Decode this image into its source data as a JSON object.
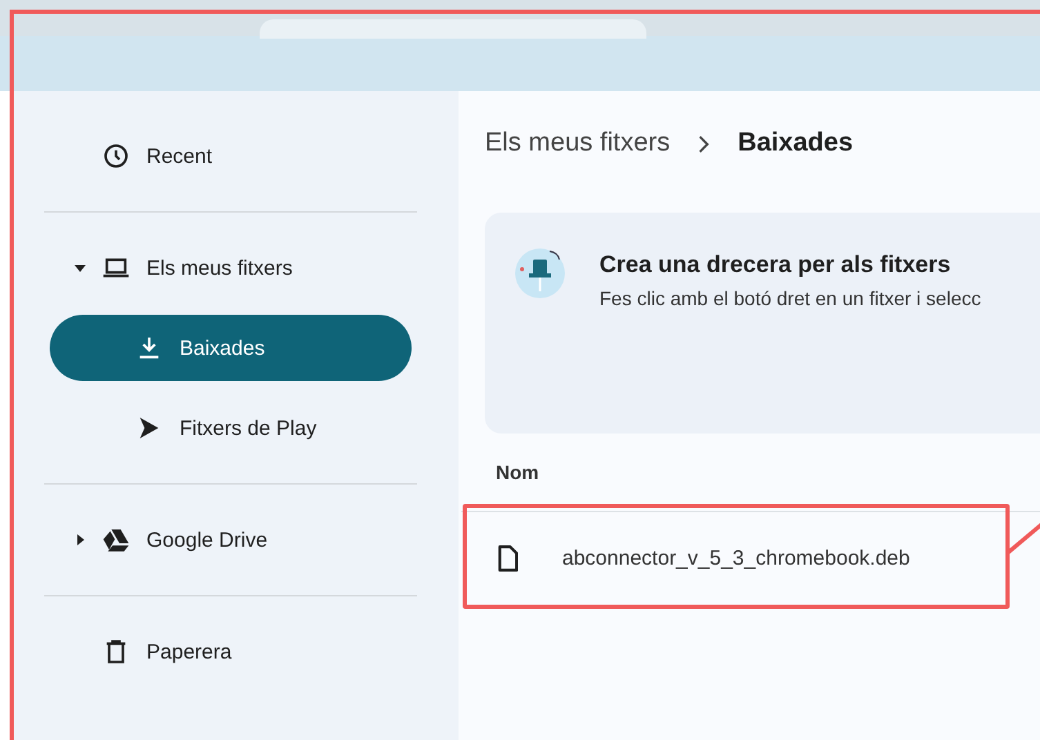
{
  "sidebar": {
    "groups": [
      [
        {
          "kind": "recent",
          "label": "Recent",
          "selected": false
        }
      ],
      [
        {
          "kind": "device",
          "label": "Els meus fitxers",
          "selected": false,
          "expanded": true,
          "children": [
            {
              "kind": "downloads",
              "label": "Baixades",
              "selected": true
            },
            {
              "kind": "play",
              "label": "Fitxers de Play",
              "selected": false
            }
          ]
        }
      ],
      [
        {
          "kind": "drive",
          "label": "Google Drive",
          "selected": false,
          "expanded": false
        }
      ],
      [
        {
          "kind": "trash",
          "label": "Paperera",
          "selected": false
        }
      ]
    ]
  },
  "breadcrumb": [
    "Els meus fitxers",
    "Baixades"
  ],
  "banner": {
    "title": "Crea una drecera per als fitxers",
    "text": "Fes clic amb el botó dret en un fitxer i selecc"
  },
  "file_list": {
    "columns": [
      "Nom"
    ],
    "rows": [
      {
        "name": "abconnector_v_5_3_chromebook.deb"
      }
    ]
  }
}
